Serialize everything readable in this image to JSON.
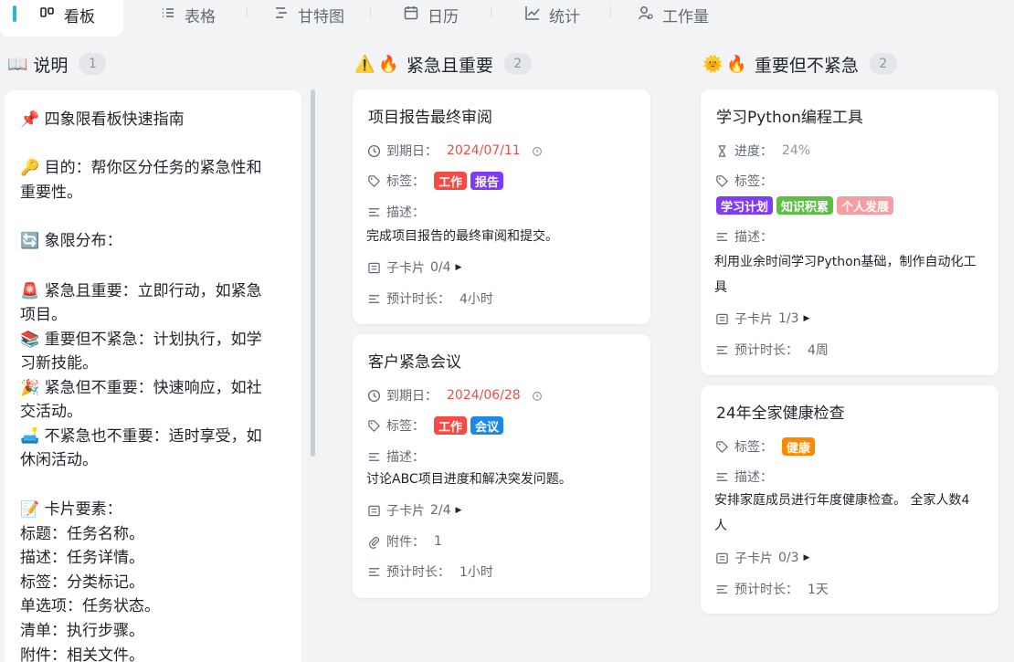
{
  "tabs": [
    {
      "label": "看板",
      "icon": "kanban-icon"
    },
    {
      "label": "表格",
      "icon": "list-icon"
    },
    {
      "label": "甘特图",
      "icon": "gantt-icon"
    },
    {
      "label": "日历",
      "icon": "calendar-icon"
    },
    {
      "label": "统计",
      "icon": "chart-icon"
    },
    {
      "label": "工作量",
      "icon": "workload-icon"
    }
  ],
  "columns": {
    "guide": {
      "title": "说明",
      "emoji": "📖",
      "count": "1"
    },
    "urgent_important": {
      "title": "紧急且重要",
      "emoji": "⚠️🔥",
      "count": "2"
    },
    "important_not_urgent": {
      "title": "重要但不紧急",
      "emoji": "🌞🔥",
      "count": "2"
    }
  },
  "guide_card": {
    "lines": [
      "📌 四象限看板快速指南",
      "",
      "🔑 目的：帮你区分任务的紧急性和",
      "重要性。",
      "",
      "🔄 象限分布：",
      "",
      "🚨 紧急且重要：立即行动，如紧急",
      "项目。",
      "📚 重要但不紧急：计划执行，如学",
      "习新技能。",
      "🎉 紧急但不重要：快速响应，如社",
      "交活动。",
      "🛋️ 不紧急也不重要：适时享受，如",
      "休闲活动。",
      "",
      "📝 卡片要素：",
      "标题：任务名称。",
      "描述：任务详情。",
      "标签：分类标记。",
      "单选项：任务状态。",
      "清单：执行步骤。",
      "附件：相关文件。"
    ]
  },
  "labels": {
    "due": "到期日：",
    "tags": "标签：",
    "desc": "描述：",
    "subcards": "子卡片",
    "attachments": "附件：",
    "duration": "预计时长：",
    "progress": "进度："
  },
  "cards": {
    "report": {
      "title": "项目报告最终审阅",
      "due": "2024/07/11",
      "tags": [
        {
          "text": "工作",
          "color": "#f54a45"
        },
        {
          "text": "报告",
          "color": "#7f3bf5"
        }
      ],
      "desc": "完成项目报告的最终审阅和提交。",
      "subcards": "0/4",
      "duration": "4小时"
    },
    "meeting": {
      "title": "客户紧急会议",
      "due": "2024/06/28",
      "tags": [
        {
          "text": "工作",
          "color": "#f54a45"
        },
        {
          "text": "会议",
          "color": "#1e88e5"
        }
      ],
      "desc": "讨论ABC项目进度和解决突发问题。",
      "subcards": "2/4",
      "attachments": "1",
      "duration": "1小时"
    },
    "python": {
      "title": "学习Python编程工具",
      "progress": "24%",
      "tags": [
        {
          "text": "学习计划",
          "color": "#7f3bf5"
        },
        {
          "text": "知识积累",
          "color": "#5bc041"
        },
        {
          "text": "个人发展",
          "color": "#f59ea0"
        }
      ],
      "desc": "利用业余时间学习Python基础，制作自动化工具",
      "subcards": "1/3",
      "duration": "4周"
    },
    "health": {
      "title": "24年全家健康检查",
      "tags": [
        {
          "text": "健康",
          "color": "#ff8800"
        }
      ],
      "desc": "安排家庭成员进行年度健康检查。 全家人数4人",
      "subcards": "0/3",
      "duration": "1天"
    }
  }
}
